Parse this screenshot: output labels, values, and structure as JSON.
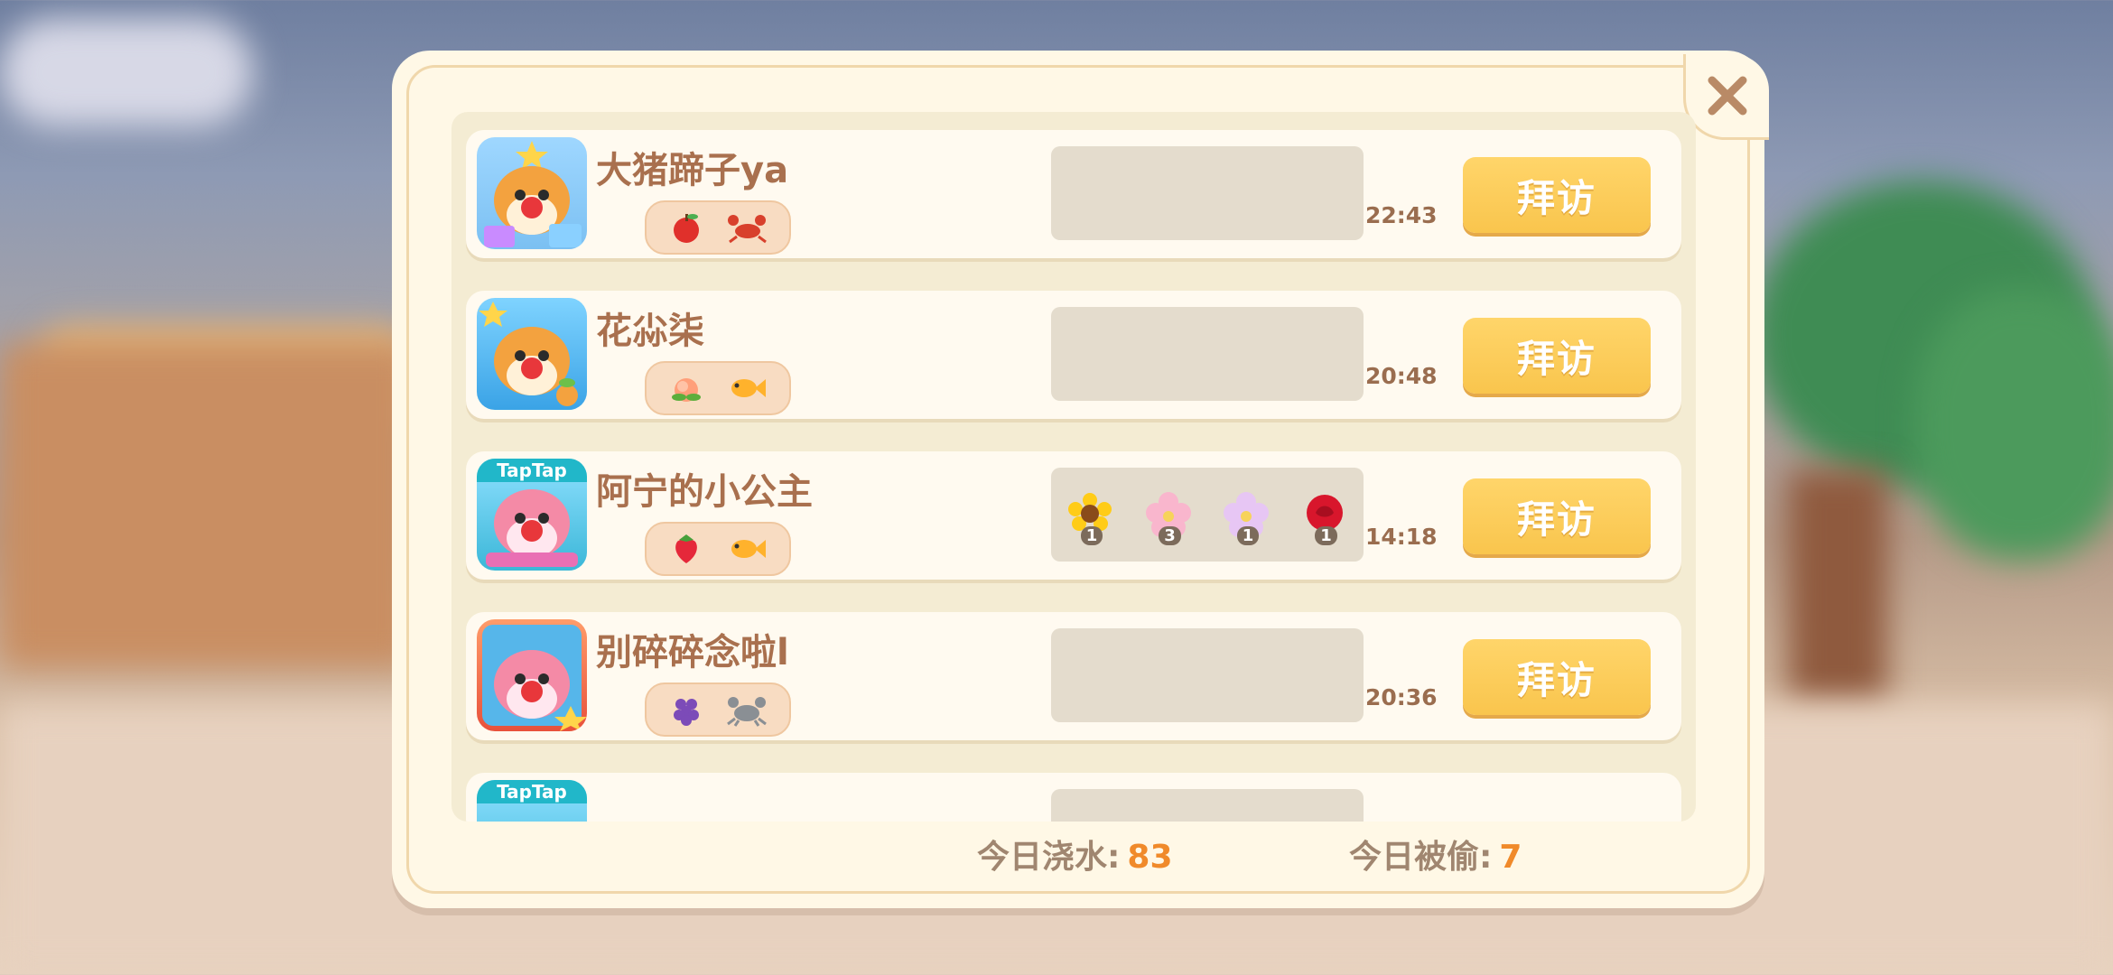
{
  "friends": [
    {
      "name": "大猪蹄子ya",
      "time": "22:43",
      "visit_label": "拜访",
      "items": [
        "apple-icon",
        "lobster-icon"
      ],
      "flowers": []
    },
    {
      "name": "花尛柒",
      "time": "20:48",
      "visit_label": "拜访",
      "items": [
        "peach-icon",
        "goldfish-icon"
      ],
      "flowers": []
    },
    {
      "name": "阿宁的小公主",
      "time": "14:18",
      "visit_label": "拜访",
      "items": [
        "strawberry-icon",
        "goldfish-icon"
      ],
      "flowers": [
        {
          "icon": "sunflower-icon",
          "count": "1"
        },
        {
          "icon": "pink-flower-icon",
          "count": "3"
        },
        {
          "icon": "violet-flower-icon",
          "count": "1"
        },
        {
          "icon": "rose-icon",
          "count": "1"
        }
      ],
      "badge": "TapTap"
    },
    {
      "name": "别碎碎念啦l",
      "time": "20:36",
      "visit_label": "拜访",
      "items": [
        "grapes-icon",
        "crab-icon"
      ],
      "flowers": []
    }
  ],
  "partial_row": {
    "badge": "TapTap"
  },
  "footer": {
    "watered_label": "今日浇水:",
    "watered_value": "83",
    "stolen_label": "今日被偷:",
    "stolen_value": "7"
  },
  "colors": {
    "accent": "#f9c54d",
    "number": "#f08a2a",
    "name": "#a9704e"
  }
}
